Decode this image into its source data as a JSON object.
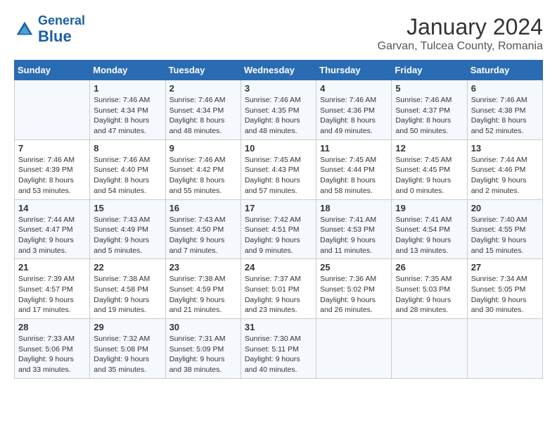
{
  "header": {
    "logo_line1": "General",
    "logo_line2": "Blue",
    "title": "January 2024",
    "subtitle": "Garvan, Tulcea County, Romania"
  },
  "weekdays": [
    "Sunday",
    "Monday",
    "Tuesday",
    "Wednesday",
    "Thursday",
    "Friday",
    "Saturday"
  ],
  "weeks": [
    [
      {
        "day": "",
        "info": ""
      },
      {
        "day": "1",
        "info": "Sunrise: 7:46 AM\nSunset: 4:34 PM\nDaylight: 8 hours\nand 47 minutes."
      },
      {
        "day": "2",
        "info": "Sunrise: 7:46 AM\nSunset: 4:34 PM\nDaylight: 8 hours\nand 48 minutes."
      },
      {
        "day": "3",
        "info": "Sunrise: 7:46 AM\nSunset: 4:35 PM\nDaylight: 8 hours\nand 48 minutes."
      },
      {
        "day": "4",
        "info": "Sunrise: 7:46 AM\nSunset: 4:36 PM\nDaylight: 8 hours\nand 49 minutes."
      },
      {
        "day": "5",
        "info": "Sunrise: 7:46 AM\nSunset: 4:37 PM\nDaylight: 8 hours\nand 50 minutes."
      },
      {
        "day": "6",
        "info": "Sunrise: 7:46 AM\nSunset: 4:38 PM\nDaylight: 8 hours\nand 52 minutes."
      }
    ],
    [
      {
        "day": "7",
        "info": "Sunrise: 7:46 AM\nSunset: 4:39 PM\nDaylight: 8 hours\nand 53 minutes."
      },
      {
        "day": "8",
        "info": "Sunrise: 7:46 AM\nSunset: 4:40 PM\nDaylight: 8 hours\nand 54 minutes."
      },
      {
        "day": "9",
        "info": "Sunrise: 7:46 AM\nSunset: 4:42 PM\nDaylight: 8 hours\nand 55 minutes."
      },
      {
        "day": "10",
        "info": "Sunrise: 7:45 AM\nSunset: 4:43 PM\nDaylight: 8 hours\nand 57 minutes."
      },
      {
        "day": "11",
        "info": "Sunrise: 7:45 AM\nSunset: 4:44 PM\nDaylight: 8 hours\nand 58 minutes."
      },
      {
        "day": "12",
        "info": "Sunrise: 7:45 AM\nSunset: 4:45 PM\nDaylight: 9 hours\nand 0 minutes."
      },
      {
        "day": "13",
        "info": "Sunrise: 7:44 AM\nSunset: 4:46 PM\nDaylight: 9 hours\nand 2 minutes."
      }
    ],
    [
      {
        "day": "14",
        "info": "Sunrise: 7:44 AM\nSunset: 4:47 PM\nDaylight: 9 hours\nand 3 minutes."
      },
      {
        "day": "15",
        "info": "Sunrise: 7:43 AM\nSunset: 4:49 PM\nDaylight: 9 hours\nand 5 minutes."
      },
      {
        "day": "16",
        "info": "Sunrise: 7:43 AM\nSunset: 4:50 PM\nDaylight: 9 hours\nand 7 minutes."
      },
      {
        "day": "17",
        "info": "Sunrise: 7:42 AM\nSunset: 4:51 PM\nDaylight: 9 hours\nand 9 minutes."
      },
      {
        "day": "18",
        "info": "Sunrise: 7:41 AM\nSunset: 4:53 PM\nDaylight: 9 hours\nand 11 minutes."
      },
      {
        "day": "19",
        "info": "Sunrise: 7:41 AM\nSunset: 4:54 PM\nDaylight: 9 hours\nand 13 minutes."
      },
      {
        "day": "20",
        "info": "Sunrise: 7:40 AM\nSunset: 4:55 PM\nDaylight: 9 hours\nand 15 minutes."
      }
    ],
    [
      {
        "day": "21",
        "info": "Sunrise: 7:39 AM\nSunset: 4:57 PM\nDaylight: 9 hours\nand 17 minutes."
      },
      {
        "day": "22",
        "info": "Sunrise: 7:38 AM\nSunset: 4:58 PM\nDaylight: 9 hours\nand 19 minutes."
      },
      {
        "day": "23",
        "info": "Sunrise: 7:38 AM\nSunset: 4:59 PM\nDaylight: 9 hours\nand 21 minutes."
      },
      {
        "day": "24",
        "info": "Sunrise: 7:37 AM\nSunset: 5:01 PM\nDaylight: 9 hours\nand 23 minutes."
      },
      {
        "day": "25",
        "info": "Sunrise: 7:36 AM\nSunset: 5:02 PM\nDaylight: 9 hours\nand 26 minutes."
      },
      {
        "day": "26",
        "info": "Sunrise: 7:35 AM\nSunset: 5:03 PM\nDaylight: 9 hours\nand 28 minutes."
      },
      {
        "day": "27",
        "info": "Sunrise: 7:34 AM\nSunset: 5:05 PM\nDaylight: 9 hours\nand 30 minutes."
      }
    ],
    [
      {
        "day": "28",
        "info": "Sunrise: 7:33 AM\nSunset: 5:06 PM\nDaylight: 9 hours\nand 33 minutes."
      },
      {
        "day": "29",
        "info": "Sunrise: 7:32 AM\nSunset: 5:08 PM\nDaylight: 9 hours\nand 35 minutes."
      },
      {
        "day": "30",
        "info": "Sunrise: 7:31 AM\nSunset: 5:09 PM\nDaylight: 9 hours\nand 38 minutes."
      },
      {
        "day": "31",
        "info": "Sunrise: 7:30 AM\nSunset: 5:11 PM\nDaylight: 9 hours\nand 40 minutes."
      },
      {
        "day": "",
        "info": ""
      },
      {
        "day": "",
        "info": ""
      },
      {
        "day": "",
        "info": ""
      }
    ]
  ]
}
